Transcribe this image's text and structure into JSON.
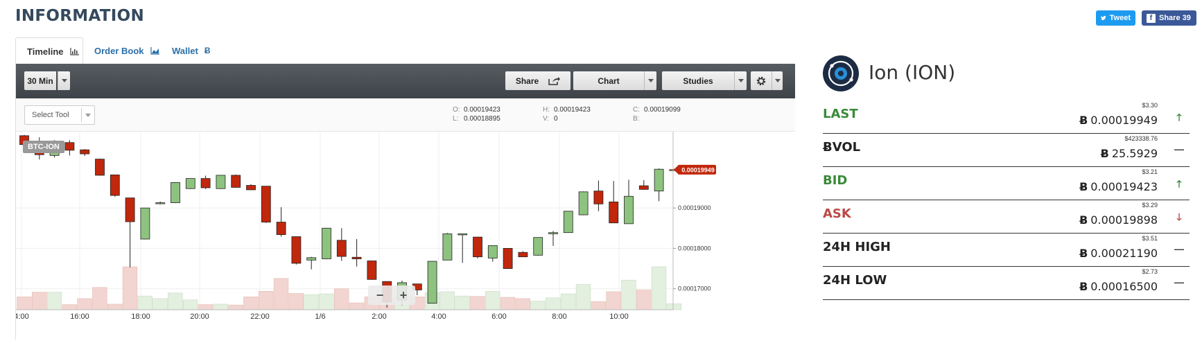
{
  "page": {
    "title": "INFORMATION"
  },
  "social": {
    "tweet_label": "Tweet",
    "share_label": "Share 39"
  },
  "tabs": [
    {
      "label": "Timeline",
      "icon": "bar-chart-icon",
      "active": true
    },
    {
      "label": "Order Book",
      "icon": "area-chart-icon",
      "active": false
    },
    {
      "label": "Wallet",
      "icon": "bitcoin-icon",
      "active": false
    }
  ],
  "toolbar": {
    "interval": "30 Min",
    "share_label": "Share",
    "chart_label": "Chart",
    "studies_label": "Studies",
    "settings_icon": "gear-icon"
  },
  "subbar": {
    "select_tool_placeholder": "Select Tool",
    "ohlc": {
      "O": "0.00019423",
      "L": "0.00018895",
      "H": "0.00019423",
      "V": "0",
      "C": "0.00019099",
      "B": ""
    }
  },
  "chart_data": {
    "type": "candlestick",
    "symbol": "BTC-ION",
    "current_price": "0.00019949",
    "y_ticks": [
      "0.00019000",
      "0.00018000",
      "0.00017000"
    ],
    "x_ticks": [
      "4:00",
      "16:00",
      "18:00",
      "20:00",
      "22:00",
      "1/6",
      "2:00",
      "4:00",
      "6:00",
      "8:00",
      "10:00"
    ],
    "ylim": [
      0.0001648,
      0.0002089
    ],
    "price_label_axis": "right",
    "colors": {
      "up": "#8dc27f",
      "down": "#c1270c",
      "vol_up": "#e3efdf",
      "vol_down": "#f2d5d0"
    },
    "candles": [
      {
        "o": 0.0002079,
        "h": 0.0002081,
        "l": 0.0002048,
        "c": 0.0002057,
        "v": 0.3
      },
      {
        "o": 0.0002065,
        "h": 0.0002075,
        "l": 0.000202,
        "c": 0.0002032,
        "v": 0.41
      },
      {
        "o": 0.000203,
        "h": 0.0002068,
        "l": 0.0002025,
        "c": 0.000206,
        "v": 0.41
      },
      {
        "o": 0.0002062,
        "h": 0.0002068,
        "l": 0.000203,
        "c": 0.0002043,
        "v": 0.12
      },
      {
        "o": 0.0002044,
        "h": 0.0002046,
        "l": 0.0002029,
        "c": 0.0002034,
        "v": 0.26
      },
      {
        "o": 0.0002021,
        "h": 0.0002022,
        "l": 0.000198,
        "c": 0.0001981,
        "v": 0.52
      },
      {
        "o": 0.0001982,
        "h": 0.0001982,
        "l": 0.0001928,
        "c": 0.0001931,
        "v": 0.13
      },
      {
        "o": 0.0001925,
        "h": 0.0001925,
        "l": 0.0001753,
        "c": 0.0001866,
        "v": 1.0
      },
      {
        "o": 0.0001823,
        "h": 0.00019,
        "l": 0.0001822,
        "c": 0.00019,
        "v": 0.32
      },
      {
        "o": 0.0001913,
        "h": 0.0001916,
        "l": 0.0001909,
        "c": 0.0001913,
        "v": 0.26
      },
      {
        "o": 0.0001913,
        "h": 0.0001964,
        "l": 0.0001912,
        "c": 0.0001963,
        "v": 0.39
      },
      {
        "o": 0.0001948,
        "h": 0.0001973,
        "l": 0.0001947,
        "c": 0.0001973,
        "v": 0.23
      },
      {
        "o": 0.0001973,
        "h": 0.000198,
        "l": 0.0001947,
        "c": 0.000195,
        "v": 0.12
      },
      {
        "o": 0.0001948,
        "h": 0.0001981,
        "l": 0.0001947,
        "c": 0.0001981,
        "v": 0.13
      },
      {
        "o": 0.0001981,
        "h": 0.0001983,
        "l": 0.000195,
        "c": 0.0001951,
        "v": 0.11
      },
      {
        "o": 0.0001956,
        "h": 0.0001959,
        "l": 0.0001945,
        "c": 0.0001945,
        "v": 0.3
      },
      {
        "o": 0.0001954,
        "h": 0.0001954,
        "l": 0.0001863,
        "c": 0.0001865,
        "v": 0.43
      },
      {
        "o": 0.0001865,
        "h": 0.0001902,
        "l": 0.0001829,
        "c": 0.0001834,
        "v": 0.73
      },
      {
        "o": 0.0001829,
        "h": 0.0001829,
        "l": 0.000176,
        "c": 0.0001763,
        "v": 0.38
      },
      {
        "o": 0.0001771,
        "h": 0.0001779,
        "l": 0.0001748,
        "c": 0.0001777,
        "v": 0.35
      },
      {
        "o": 0.0001774,
        "h": 0.0001851,
        "l": 0.0001773,
        "c": 0.000185,
        "v": 0.37
      },
      {
        "o": 0.000182,
        "h": 0.000185,
        "l": 0.0001769,
        "c": 0.000178,
        "v": 0.49
      },
      {
        "o": 0.0001778,
        "h": 0.0001823,
        "l": 0.0001755,
        "c": 0.0001774,
        "v": 0.16
      },
      {
        "o": 0.0001769,
        "h": 0.0001769,
        "l": 0.0001722,
        "c": 0.0001723,
        "v": 0.3
      },
      {
        "o": 0.0001718,
        "h": 0.0001718,
        "l": 0.0001653,
        "c": 0.0001667,
        "v": 0.27
      },
      {
        "o": 0.0001672,
        "h": 0.000172,
        "l": 0.0001659,
        "c": 0.0001715,
        "v": 0.31
      },
      {
        "o": 0.0001712,
        "h": 0.0001712,
        "l": 0.0001684,
        "c": 0.0001697,
        "v": 0.3
      },
      {
        "o": 0.0001664,
        "h": 0.0001768,
        "l": 0.0001664,
        "c": 0.0001768,
        "v": 0.4
      },
      {
        "o": 0.0001771,
        "h": 0.0001838,
        "l": 0.0001771,
        "c": 0.0001836,
        "v": 0.42
      },
      {
        "o": 0.0001836,
        "h": 0.0001836,
        "l": 0.0001764,
        "c": 0.0001836,
        "v": 0.32
      },
      {
        "o": 0.0001828,
        "h": 0.0001828,
        "l": 0.0001775,
        "c": 0.0001779,
        "v": 0.31
      },
      {
        "o": 0.0001776,
        "h": 0.0001807,
        "l": 0.0001767,
        "c": 0.0001807,
        "v": 0.43
      },
      {
        "o": 0.00018,
        "h": 0.00018,
        "l": 0.000175,
        "c": 0.000175,
        "v": 0.29
      },
      {
        "o": 0.000179,
        "h": 0.0001793,
        "l": 0.0001779,
        "c": 0.0001779,
        "v": 0.26
      },
      {
        "o": 0.0001783,
        "h": 0.0001827,
        "l": 0.0001782,
        "c": 0.0001827,
        "v": 0.2
      },
      {
        "o": 0.0001836,
        "h": 0.0001843,
        "l": 0.0001806,
        "c": 0.0001839,
        "v": 0.28
      },
      {
        "o": 0.0001839,
        "h": 0.0001892,
        "l": 0.0001839,
        "c": 0.0001892,
        "v": 0.37
      },
      {
        "o": 0.0001883,
        "h": 0.0001941,
        "l": 0.0001882,
        "c": 0.000194,
        "v": 0.59
      },
      {
        "o": 0.0001942,
        "h": 0.0001968,
        "l": 0.0001892,
        "c": 0.000191,
        "v": 0.19
      },
      {
        "o": 0.0001915,
        "h": 0.0001967,
        "l": 0.0001863,
        "c": 0.0001863,
        "v": 0.42
      },
      {
        "o": 0.0001861,
        "h": 0.000197,
        "l": 0.0001861,
        "c": 0.0001929,
        "v": 0.69
      },
      {
        "o": 0.0001955,
        "h": 0.0001969,
        "l": 0.0001945,
        "c": 0.0001946,
        "v": 0.46
      },
      {
        "o": 0.0001942,
        "h": 0.0001998,
        "l": 0.0001917,
        "c": 0.0001996,
        "v": 1.0
      },
      {
        "o": 0.0001994,
        "h": 0.0001997,
        "l": 0.0001992,
        "c": 0.0001995,
        "v": 0.14
      }
    ]
  },
  "zoom": {
    "minus": "−",
    "plus": "+"
  },
  "coin": {
    "name": "Ion (ION)",
    "logo_icon": "ion-logo-icon"
  },
  "stats": [
    {
      "label": "LAST",
      "label_color": "#3a8a3a",
      "usd": "$3.30",
      "btc_symbol": "Ƀ",
      "value": "0.00019949",
      "trend": "up",
      "trend_glyph": "🡑",
      "trend_color": "#3a8a3a"
    },
    {
      "label": "ɃVOL",
      "label_color": "#222222",
      "usd": "$423338.76",
      "btc_symbol": "Ƀ",
      "value": "25.5929",
      "trend": "flat",
      "trend_glyph": "—",
      "trend_color": "#333333"
    },
    {
      "label": "BID",
      "label_color": "#3a8a3a",
      "usd": "$3.21",
      "btc_symbol": "Ƀ",
      "value": "0.00019423",
      "trend": "up",
      "trend_glyph": "🡑",
      "trend_color": "#3a8a3a"
    },
    {
      "label": "ASK",
      "label_color": "#b94a48",
      "usd": "$3.29",
      "btc_symbol": "Ƀ",
      "value": "0.00019898",
      "trend": "down",
      "trend_glyph": "🡓",
      "trend_color": "#b94a48"
    },
    {
      "label": "24H HIGH",
      "label_color": "#222222",
      "usd": "$3.51",
      "btc_symbol": "Ƀ",
      "value": "0.00021190",
      "trend": "flat",
      "trend_glyph": "—",
      "trend_color": "#333333"
    },
    {
      "label": "24H LOW",
      "label_color": "#222222",
      "usd": "$2.73",
      "btc_symbol": "Ƀ",
      "value": "0.00016500",
      "trend": "flat",
      "trend_glyph": "—",
      "trend_color": "#333333"
    }
  ]
}
